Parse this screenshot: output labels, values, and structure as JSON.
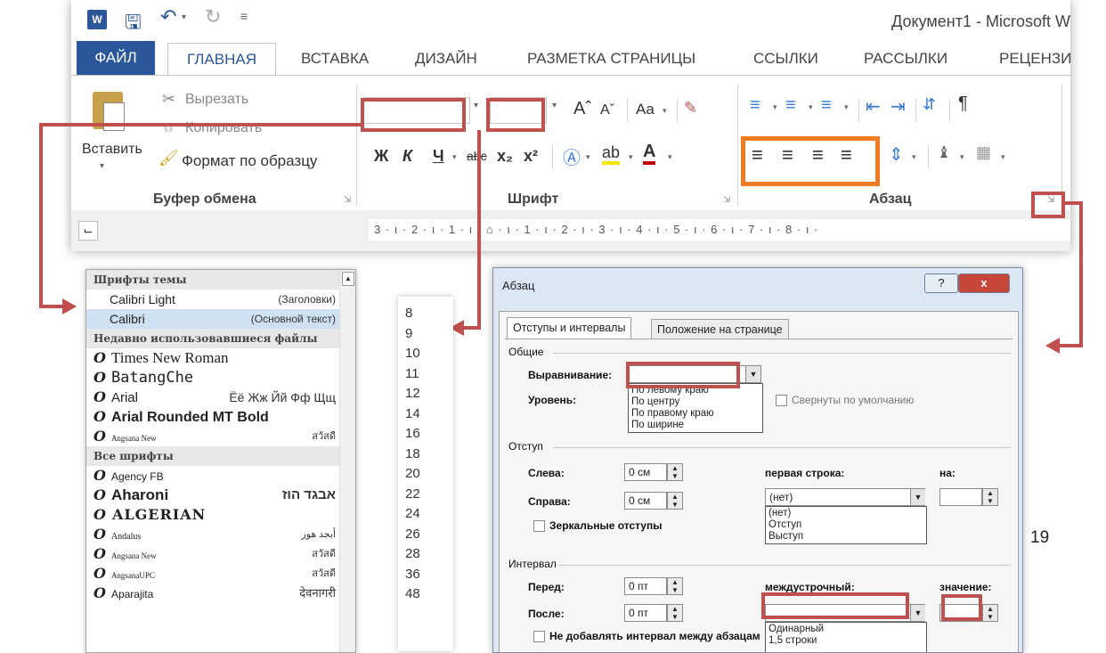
{
  "window": {
    "title": "Документ1 - Microsoft W",
    "logo": "W",
    "qat_icons": [
      "save-icon",
      "undo-icon",
      "redo-icon",
      "customize-icon"
    ]
  },
  "tabs": [
    "ФАЙЛ",
    "ГЛАВНАЯ",
    "ВСТАВКА",
    "ДИЗАЙН",
    "РАЗМЕТКА СТРАНИЦЫ",
    "ССЫЛКИ",
    "РАССЫЛКИ",
    "РЕЦЕНЗИ"
  ],
  "clipboard": {
    "paste": "Вставить",
    "cut": "Вырезать",
    "copy": "Копировать",
    "format_painter": "Формат по образцу",
    "group_label": "Буфер обмена"
  },
  "font_group": {
    "label": "Шрифт",
    "format_buttons": [
      "Ж",
      "К",
      "Ч",
      "abc",
      "x₂",
      "x²"
    ],
    "case_button": "Aa"
  },
  "paragraph_group": {
    "label": "Абзац"
  },
  "ruler": {
    "scale_text": "3 · ı · 2 · ı · 1 · ı · ⌂ · ı · 1 · ı · 2 · ı · 3 · ı · 4 · ı · 5 · ı · 6 · ı · 7 · ı · 8 · ı ·"
  },
  "font_list": {
    "theme_header": "Шрифты темы",
    "theme_fonts": [
      {
        "name": "Calibri Light",
        "hint": "(Заголовки)"
      },
      {
        "name": "Calibri",
        "hint": "(Основной текст)"
      }
    ],
    "recent_header": "Недавно использовавшиеся файлы",
    "recent_fonts": [
      {
        "name": "Times New Roman",
        "sample": ""
      },
      {
        "name": "BatangChe",
        "sample": ""
      },
      {
        "name": "Arial",
        "sample": "Ёё Жж Йй Фф Щщ"
      },
      {
        "name": "Arial Rounded MT Bold",
        "sample": ""
      },
      {
        "name": "Angsana New",
        "sample": "สวัสดี"
      }
    ],
    "all_header": "Все шрифты",
    "all_fonts": [
      {
        "name": "Agency FB",
        "sample": ""
      },
      {
        "name": "Aharoni",
        "sample": "אבגד הוז"
      },
      {
        "name": "ALGERIAN",
        "sample": ""
      },
      {
        "name": "Andalus",
        "sample": "أبجد هوز"
      },
      {
        "name": "Angsana New",
        "sample": "สวัสดี"
      },
      {
        "name": "AngsanaUPC",
        "sample": "สวัสดี"
      },
      {
        "name": "Aparajita",
        "sample": "देवनागरी"
      }
    ]
  },
  "size_list": [
    "8",
    "9",
    "10",
    "11",
    "12",
    "14",
    "16",
    "18",
    "20",
    "22",
    "24",
    "26",
    "28",
    "36",
    "48"
  ],
  "dialog": {
    "title": "Абзац",
    "help": "?",
    "close": "x",
    "tabs": [
      "Отступы и интервалы",
      "Положение на странице"
    ],
    "general": "Общие",
    "alignment_label": "Выравнивание:",
    "alignment_options": [
      "По левому краю",
      "По центру",
      "По правому краю",
      "По ширине"
    ],
    "level_label": "Уровень:",
    "collapsed_label": "Свернуты по умолчанию",
    "indent": "Отступ",
    "left_label": "Слева:",
    "left_value": "0 см",
    "right_label": "Справа:",
    "right_value": "0 см",
    "first_line_label": "первая строка:",
    "first_line_value": "(нет)",
    "first_line_options": [
      "(нет)",
      "Отступ",
      "Выступ"
    ],
    "by_label": "на:",
    "mirror_label": "Зеркальные отступы",
    "spacing": "Интервал",
    "before_label": "Перед:",
    "before_value": "0 пт",
    "after_label": "После:",
    "after_value": "0 пт",
    "line_spacing_label": "междустрочный:",
    "line_spacing_options": [
      "Одинарный",
      "1,5 строки"
    ],
    "value_label": "значение:",
    "no_space_label": "Не добавлять интервал между абзацам"
  },
  "page_number": "19",
  "colors": {
    "accent": "#2b579a",
    "annotation_red": "#c0504d",
    "annotation_orange": "#f07c22"
  }
}
